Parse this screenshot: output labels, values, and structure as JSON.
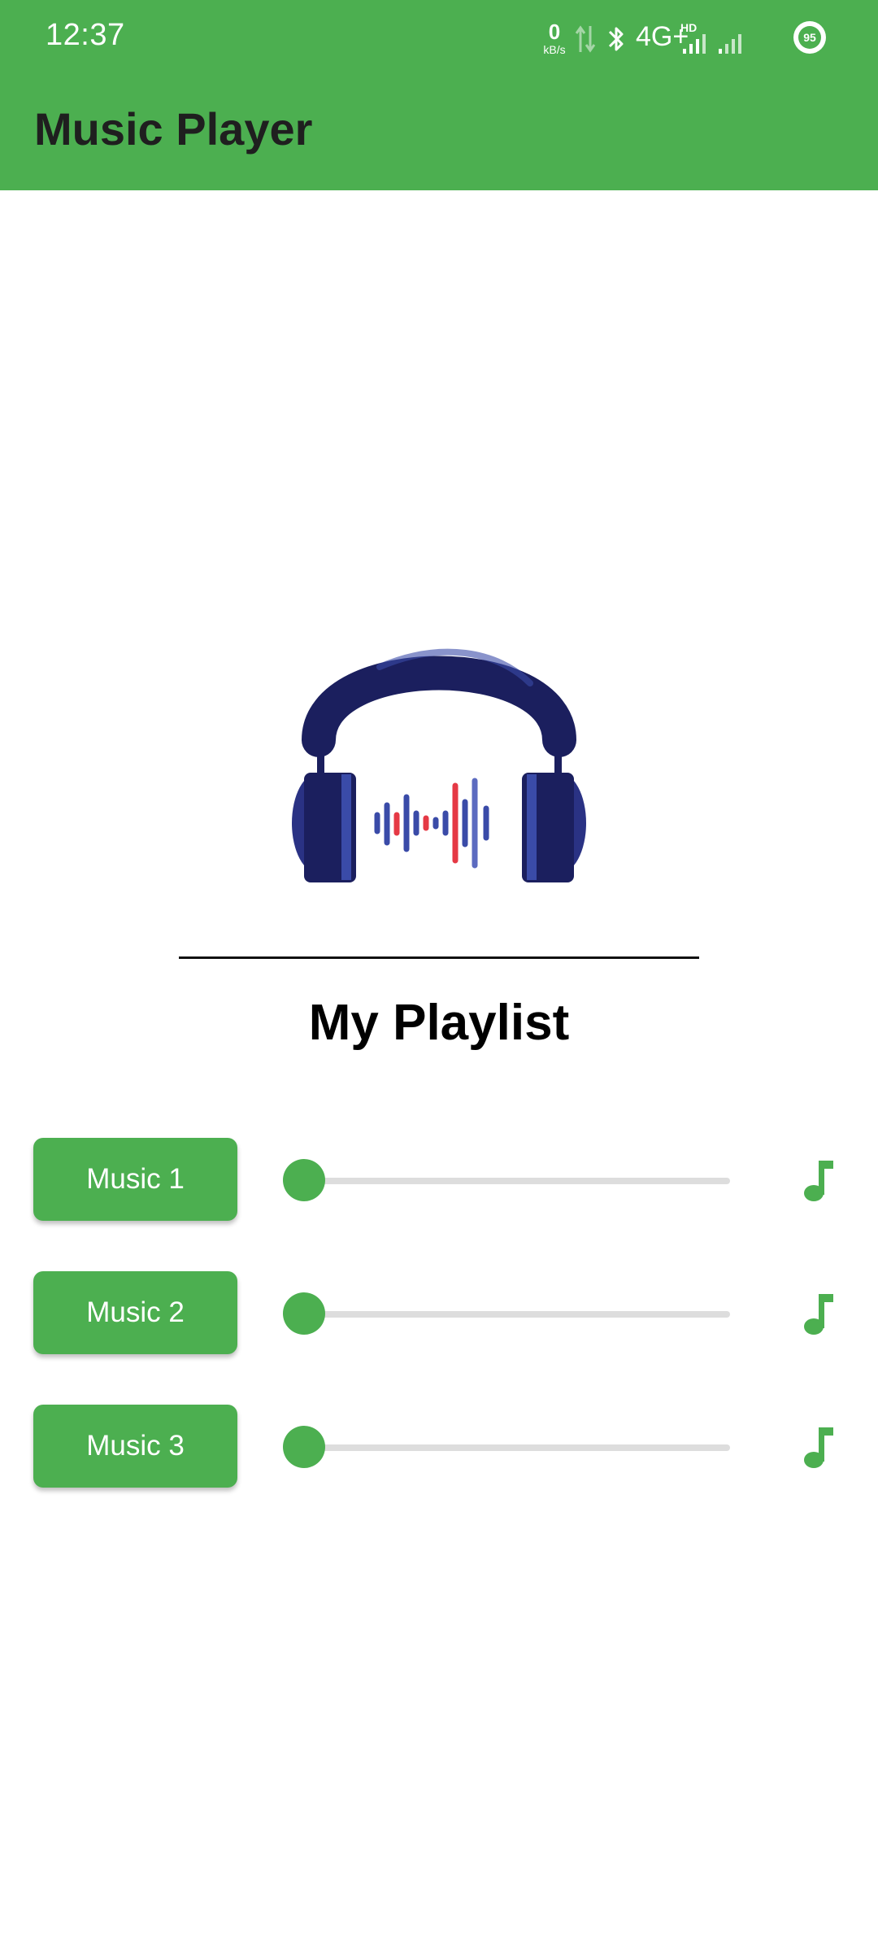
{
  "status_bar": {
    "time": "12:37",
    "net_speed_value": "0",
    "net_speed_unit": "kB/s",
    "network_type": "4G+",
    "hd_label": "HD",
    "battery_level": "95"
  },
  "app_bar": {
    "title": "Music Player"
  },
  "playlist": {
    "title": "My Playlist",
    "tracks": [
      {
        "label": "Music 1",
        "progress": 0,
        "icon": "music-note-icon"
      },
      {
        "label": "Music 2",
        "progress": 0,
        "icon": "music-note-icon"
      },
      {
        "label": "Music 3",
        "progress": 0,
        "icon": "music-note-icon"
      }
    ]
  },
  "logo_icon": "headphones-soundwave-icon",
  "colors": {
    "primary": "#4CAF50",
    "track_inactive": "#DDDDDD",
    "logo_dark": "#1B1F5E",
    "logo_blue": "#3A4BA8",
    "logo_red": "#E53945"
  }
}
